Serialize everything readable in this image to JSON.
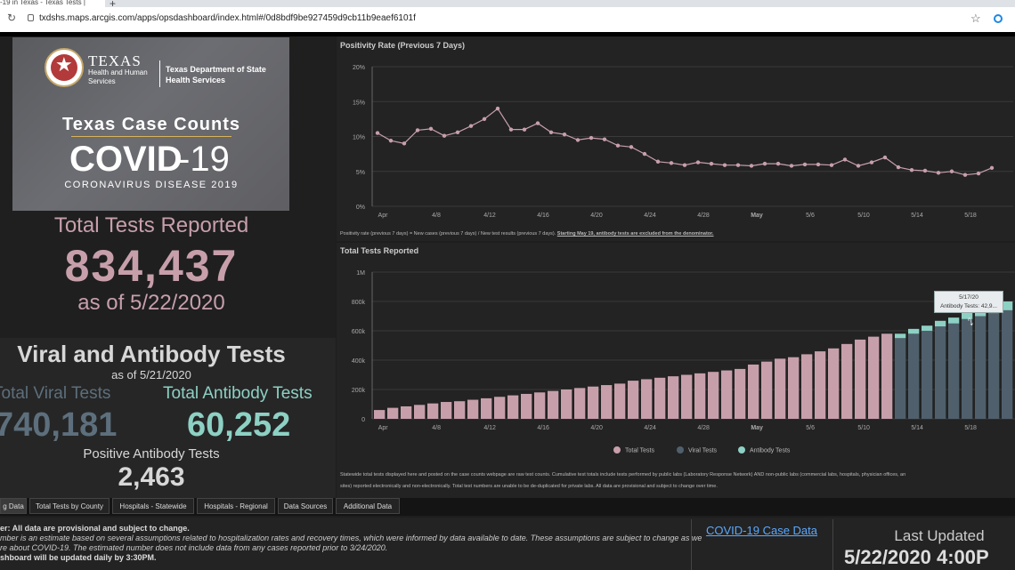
{
  "browser": {
    "tab_title": "-19 in Texas - Texas Tests |",
    "new_tab": "+",
    "url": "txdshs.maps.arcgis.com/apps/opsdashboard/index.html#/0d8bdf9be927459d9cb11b9eaef6101f",
    "reload_icon": "reload-icon",
    "star_icon": "star-icon"
  },
  "banner": {
    "agency_line1": "TEXAS",
    "agency_line2": "Health and Human",
    "agency_line3": "Services",
    "dshs_line1": "Texas Department of State",
    "dshs_line2": "Health Services",
    "title": "Texas Case Counts",
    "covid": "COVID",
    "covid_suffix": "-19",
    "subtitle": "CORONAVIRUS DISEASE 2019"
  },
  "total_tests": {
    "label": "Total Tests Reported",
    "value": "834,437",
    "as_of": "as of 5/22/2020"
  },
  "viral_antibody": {
    "title": "Viral and Antibody Tests",
    "as_of": "as of 5/21/2020",
    "viral_label": "Total Viral Tests",
    "viral_value": "740,181",
    "antibody_label": "Total Antibody Tests",
    "antibody_value": "60,252",
    "positive_label": "Positive Antibody Tests",
    "positive_value": "2,463"
  },
  "positivity_chart": {
    "title": "Positivity Rate (Previous 7 Days)",
    "note_prefix": "Positivity rate (previous 7 days) = New cases (previous 7 days) / New test results (previous 7 days). ",
    "note_link": "Starting May 19, antibody tests are excluded from the denominator."
  },
  "tests_chart": {
    "title": "Total Tests Reported",
    "legend_total": "Total Tests",
    "legend_viral": "Viral Tests",
    "legend_antibody": "Antibody Tests",
    "note_line1": "Statewide total tests displayed here and posted on the case counts webpage are raw test counts. Cumulative test totals include tests performed by public labs (Laboratory Response Network) AND non-public labs (commercial labs, hospitals, physician offices, an",
    "note_line2": "sites) reported electronically and non-electronically. Total test numbers are unable to be de-duplicated for private labs.  All data are provisional and subject to change over time.",
    "tooltip_date": "5/17/20",
    "tooltip_value": "Antibody Tests: 42,9..."
  },
  "tabs": [
    "g Data",
    "Total Tests by County",
    "Hospitals - Statewide",
    "Hospitals - Regional",
    "Data Sources",
    "Additional Data"
  ],
  "footer": {
    "disclaimer1": "er: All data are provisional and subject to change.",
    "disclaimer2": "mber is an estimate based on several assumptions related to hospitalization rates and recovery times, which were informed by data available to date. These assumptions are subject to change as we",
    "disclaimer3": "re about COVID-19. The estimated number does not include data from any cases reported prior to 3/24/2020.",
    "disclaimer4": "shboard will be updated daily by 3:30PM.",
    "case_link": "COVID-19 Case Data",
    "last_updated_label": "Last Updated",
    "last_updated_value": "5/22/2020 4:00P"
  },
  "colors": {
    "total": "#c79fab",
    "viral": "#4f606c",
    "antibody": "#8dd1c4",
    "line": "#c79fab"
  },
  "chart_data": [
    {
      "type": "line",
      "title": "Positivity Rate (Previous 7 Days)",
      "ylim": [
        0,
        20
      ],
      "y_ticks": [
        "0%",
        "5%",
        "10%",
        "15%",
        "20%"
      ],
      "x_ticks": [
        "Apr",
        "4/8",
        "4/12",
        "4/16",
        "4/20",
        "4/24",
        "4/28",
        "May",
        "5/6",
        "5/10",
        "5/14",
        "5/18"
      ],
      "x_start_day": 1,
      "values": [
        10.5,
        9.4,
        9.0,
        10.9,
        11.1,
        10.1,
        10.6,
        11.5,
        12.5,
        14.0,
        11.0,
        11.0,
        11.9,
        10.6,
        10.3,
        9.5,
        9.8,
        9.6,
        8.7,
        8.5,
        7.5,
        6.4,
        6.2,
        5.9,
        6.3,
        6.1,
        5.9,
        5.9,
        5.8,
        6.1,
        6.1,
        5.8,
        6.0,
        6.0,
        5.9,
        6.7,
        5.8,
        6.3,
        7.0,
        5.6,
        5.2,
        5.1,
        4.8,
        5.0,
        4.5,
        4.7,
        5.5
      ],
      "grid": true
    },
    {
      "type": "bar",
      "title": "Total Tests Reported",
      "ylim": [
        0,
        1000000
      ],
      "y_ticks": [
        "0",
        "200k",
        "400k",
        "600k",
        "800k",
        "1M"
      ],
      "x_ticks": [
        "Apr",
        "4/8",
        "4/12",
        "4/16",
        "4/20",
        "4/24",
        "4/28",
        "May",
        "5/6",
        "5/10",
        "5/14",
        "5/18"
      ],
      "series": [
        {
          "name": "Total Tests",
          "values": [
            60000,
            75000,
            85000,
            95000,
            105000,
            115000,
            120000,
            130000,
            140000,
            150000,
            160000,
            170000,
            180000,
            190000,
            200000,
            210000,
            220000,
            230000,
            240000,
            260000,
            270000,
            280000,
            290000,
            300000,
            310000,
            320000,
            330000,
            340000,
            370000,
            390000,
            410000,
            420000,
            440000,
            460000,
            480000,
            510000,
            540000,
            560000,
            580000
          ]
        },
        {
          "name": "Viral Tests",
          "values": [
            550000,
            580000,
            600000,
            630000,
            650000,
            680000,
            700000,
            720000,
            740000
          ]
        },
        {
          "name": "Antibody Tests",
          "values": [
            30000,
            33000,
            35000,
            38000,
            40000,
            42000,
            43000,
            45000,
            60000
          ]
        }
      ],
      "legend": "bottom"
    }
  ]
}
